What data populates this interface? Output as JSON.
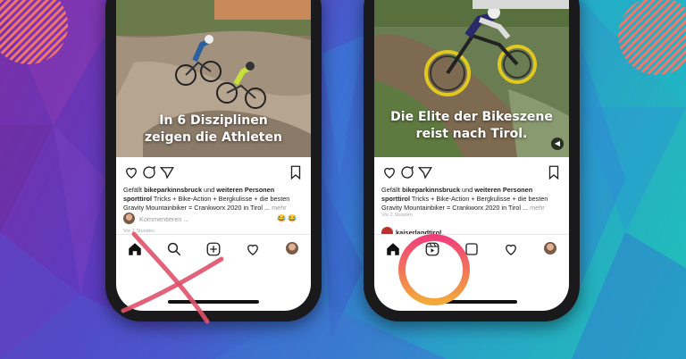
{
  "left_post": {
    "caption_line1": "In 6 Disziplinen",
    "caption_line2": "zeigen die Athleten",
    "liked_prefix": "Gefällt",
    "liked_user": "bikeparkinnsbruck",
    "liked_mid": "und",
    "liked_others": "weiteren Personen",
    "author": "sporttirol",
    "caption_text": " Tricks + Bike-Action + Bergkulisse + die besten Gravity Mountainbiker = Crankworx 2020 in Tirol ...",
    "more_label": "mehr",
    "comment_placeholder": "Kommentieren ...",
    "emojis": [
      "😂",
      "😂"
    ],
    "time_ago": "Vor 2 Stunden"
  },
  "right_post": {
    "caption_line1": "Die Elite der Bikeszene",
    "caption_line2": "reist nach Tirol.",
    "liked_prefix": "Gefällt",
    "liked_user": "bikeparkinnsbruck",
    "liked_mid": "und",
    "liked_others": "weiteren Personen",
    "author": "sporttirol",
    "caption_text": " Tricks + Bike-Action + Bergkulisse + die besten Gravity Mountainbiker = Crankworx 2020 in Tirol ...",
    "more_label": "mehr",
    "next_user": "kaiserlandtirol",
    "time_ago": "Vor 2 Stunden"
  },
  "icons": {
    "actions": [
      "heart-icon",
      "comment-icon",
      "share-icon",
      "bookmark-icon"
    ],
    "left_nav": [
      "home-icon",
      "search-icon",
      "add-icon",
      "activity-heart-icon",
      "profile-avatar"
    ],
    "right_nav": [
      "home-icon",
      "reels-icon",
      "shop-icon",
      "activity-heart-icon",
      "profile-avatar"
    ]
  },
  "colors": {
    "cross": "#e0506a",
    "highlight_ring_start": "#f0407a",
    "highlight_ring_end": "#f3a93a",
    "stripe_accent": "#f3766a"
  }
}
